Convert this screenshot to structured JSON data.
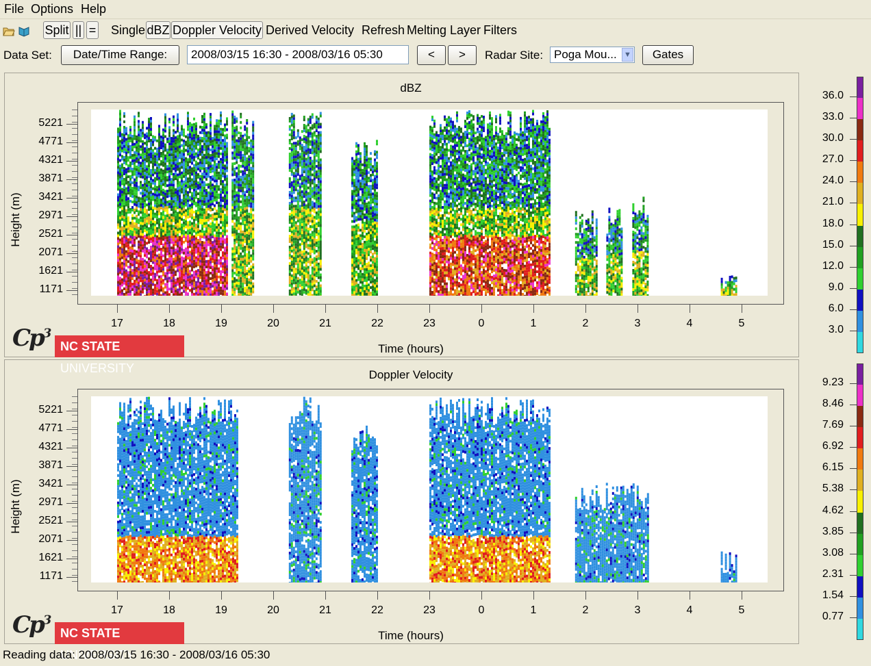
{
  "menu": {
    "items": [
      "File",
      "Options",
      "Help"
    ]
  },
  "toolbar": {
    "icons": [
      "open-folder-icon",
      "open-book-icon"
    ],
    "split_label": "Split",
    "parallel_label": "||",
    "equal_label": "=",
    "single_label": "Single",
    "dbz_label": "dBZ",
    "doppler_label": "Doppler Velocity",
    "derived_label": "Derived Velocity",
    "refresh_label": "Refresh",
    "melting_label": "Melting Layer",
    "filters_label": "Filters"
  },
  "dataset": {
    "label": "Data Set:",
    "date_button": "Date/Time Range:",
    "range_value": "2008/03/15 16:30 - 2008/03/16 05:30",
    "prev_label": "<",
    "next_label": ">",
    "radar_label": "Radar Site:",
    "radar_value": "Poga Mou...",
    "gates_label": "Gates"
  },
  "panels": [
    {
      "title": "dBZ",
      "ylabel": "Height (m)",
      "xlabel": "Time (hours)",
      "colorbar_labels": [
        "36.0",
        "33.0",
        "30.0",
        "27.0",
        "24.0",
        "21.0",
        "18.0",
        "15.0",
        "12.0",
        "9.0",
        "6.0",
        "3.0"
      ]
    },
    {
      "title": "Doppler Velocity",
      "ylabel": "Height (m)",
      "xlabel": "Time (hours)",
      "colorbar_labels": [
        "9.23",
        "8.46",
        "7.69",
        "6.92",
        "6.15",
        "5.38",
        "4.62",
        "3.85",
        "3.08",
        "2.31",
        "1.54",
        "0.77"
      ]
    }
  ],
  "yticks": [
    "5221",
    "4771",
    "4321",
    "3871",
    "3421",
    "2971",
    "2521",
    "2071",
    "1621",
    "1171"
  ],
  "xticks": [
    "17",
    "18",
    "19",
    "20",
    "21",
    "22",
    "23",
    "0",
    "1",
    "2",
    "3",
    "4",
    "5"
  ],
  "colorbar_colors": [
    "#7a1fa0",
    "#ec30c8",
    "#8a2a12",
    "#e01e1e",
    "#f07a10",
    "#e0b020",
    "#f8f000",
    "#207020",
    "#20a020",
    "#30d030",
    "#1010c0",
    "#3090e0",
    "#30d8e0"
  ],
  "logo": {
    "cp3": "Cp3",
    "ncsu_bold": "NC STATE",
    "ncsu_light": "UNIVERSITY"
  },
  "chart_data": [
    {
      "type": "heatmap",
      "title": "dBZ",
      "xlabel": "Time (hours)",
      "ylabel": "Height (m)",
      "x_ticks": [
        "17",
        "18",
        "19",
        "20",
        "21",
        "22",
        "23",
        "0",
        "1",
        "2",
        "3",
        "4",
        "5"
      ],
      "y_ticks": [
        5221,
        4771,
        4321,
        3871,
        3421,
        2971,
        2521,
        2071,
        1621,
        1171
      ],
      "colorbar": [
        3.0,
        6.0,
        9.0,
        12.0,
        15.0,
        18.0,
        21.0,
        24.0,
        27.0,
        30.0,
        33.0,
        36.0
      ],
      "echo_regions": [
        {
          "x": [
            17.0,
            19.1
          ],
          "y": [
            1171,
            5400
          ],
          "core": [
            1171,
            2520
          ],
          "peak": 36
        },
        {
          "x": [
            19.2,
            19.6
          ],
          "y": [
            1171,
            5400
          ],
          "peak": 15
        },
        {
          "x": [
            20.3,
            20.9
          ],
          "y": [
            1171,
            5400
          ],
          "peak": 9
        },
        {
          "x": [
            21.5,
            22.0
          ],
          "y": [
            1171,
            4700
          ],
          "peak": 12
        },
        {
          "x": [
            23.0,
            1.3
          ],
          "y": [
            1171,
            5400
          ],
          "core": [
            1171,
            2520
          ],
          "peak": 33
        },
        {
          "x": [
            1.8,
            2.2
          ],
          "y": [
            1171,
            2970
          ],
          "peak": 21
        },
        {
          "x": [
            2.4,
            2.7
          ],
          "y": [
            1171,
            3100
          ],
          "peak": 21
        },
        {
          "x": [
            2.9,
            3.2
          ],
          "y": [
            1171,
            3300
          ],
          "peak": 27
        },
        {
          "x": [
            4.6,
            4.9
          ],
          "y": [
            1171,
            1700
          ],
          "peak": 9
        }
      ]
    },
    {
      "type": "heatmap",
      "title": "Doppler Velocity",
      "xlabel": "Time (hours)",
      "ylabel": "Height (m)",
      "x_ticks": [
        "17",
        "18",
        "19",
        "20",
        "21",
        "22",
        "23",
        "0",
        "1",
        "2",
        "3",
        "4",
        "5"
      ],
      "y_ticks": [
        5221,
        4771,
        4321,
        3871,
        3421,
        2971,
        2521,
        2071,
        1621,
        1171
      ],
      "colorbar": [
        0.77,
        1.54,
        2.31,
        3.08,
        3.85,
        4.62,
        5.38,
        6.15,
        6.92,
        7.69,
        8.46,
        9.23
      ],
      "echo_regions": [
        {
          "x": [
            17.0,
            19.3
          ],
          "y": [
            1171,
            5400
          ],
          "core": [
            1171,
            2200
          ],
          "peak": 6.92
        },
        {
          "x": [
            20.3,
            20.9
          ],
          "y": [
            1171,
            5400
          ],
          "peak": 2.31
        },
        {
          "x": [
            21.5,
            22.0
          ],
          "y": [
            1171,
            4700
          ],
          "peak": 4.62
        },
        {
          "x": [
            23.0,
            1.3
          ],
          "y": [
            1171,
            5400
          ],
          "core": [
            1171,
            2200
          ],
          "peak": 6.92
        },
        {
          "x": [
            1.8,
            3.2
          ],
          "y": [
            1171,
            3300
          ],
          "peak": 4.62
        },
        {
          "x": [
            4.6,
            4.9
          ],
          "y": [
            1171,
            1700
          ],
          "peak": 2.31
        }
      ]
    }
  ],
  "status": "Reading data: 2008/03/15 16:30 - 2008/03/16 05:30"
}
